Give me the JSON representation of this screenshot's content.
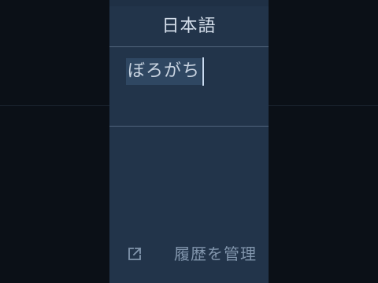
{
  "language": {
    "title": "日本語"
  },
  "input": {
    "composition_text": "ぼろがち"
  },
  "footer": {
    "icon": "external-link-icon",
    "manage_history_label": "履歴を管理"
  },
  "colors": {
    "background": "#0b1017",
    "panel": "#22344a",
    "composition_highlight": "#2f4762",
    "caret": "#c8daf0",
    "divider": "#51657d",
    "muted_text": "#8296ad"
  }
}
